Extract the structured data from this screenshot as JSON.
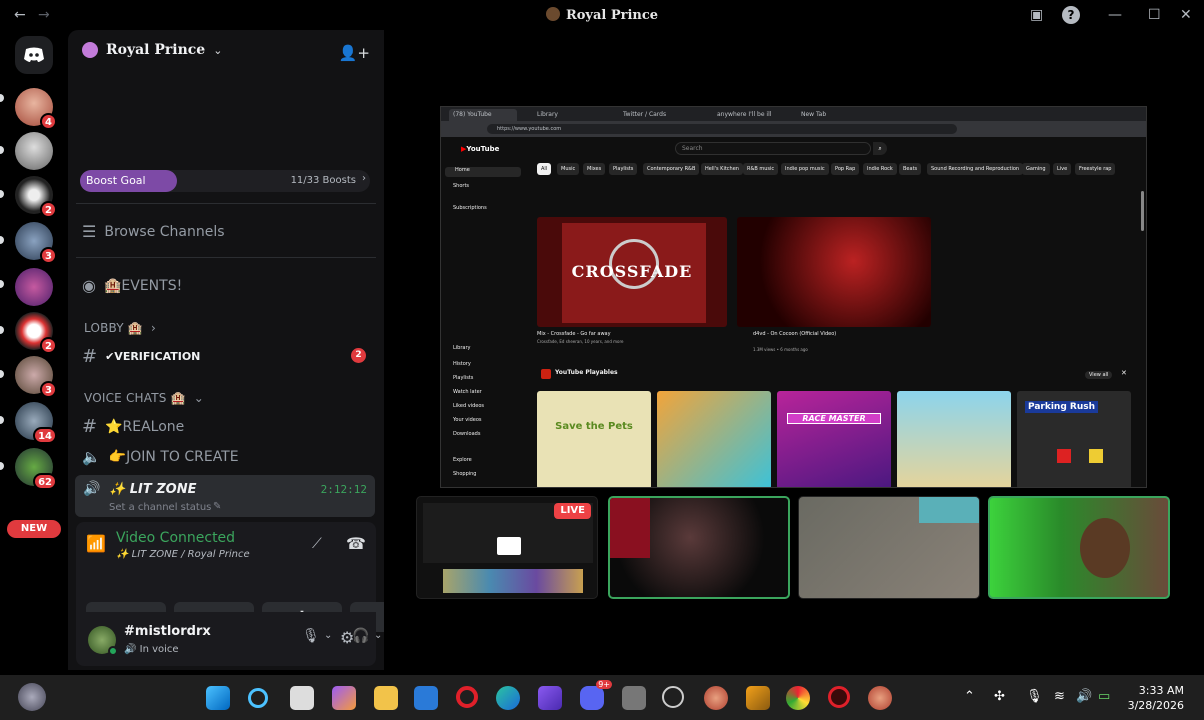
{
  "window": {
    "title": "Royal Prince",
    "back_icon": "back-arrow-icon",
    "forward_icon": "forward-arrow-icon",
    "controls": [
      "inbox-icon",
      "help-icon",
      "minimize-icon",
      "maximize-icon",
      "close-icon"
    ]
  },
  "servers": {
    "badges": [
      "4",
      "2",
      "3",
      "2",
      "3",
      "14",
      "62"
    ],
    "new_label": "NEW"
  },
  "guild": {
    "name": "Royal Prince",
    "boost_label": "Boost Goal",
    "boost_count": "11/33 Boosts",
    "boost_progress": 0.3333
  },
  "channels": {
    "browse": "Browse Channels",
    "events": "🏨EVENTS!",
    "lobby_category": "LOBBY 🏨",
    "verification": "✔VERIFICATION",
    "verification_badge": "2",
    "voice_category": "VOICE CHATS 🏨",
    "realone": "⭐REALone",
    "join_to_create": "👉JOIN TO CREATE",
    "lit_zone": "✨ LIT ZONE",
    "lit_zone_timer": "2:12:12",
    "lit_zone_status": "Set a channel status"
  },
  "voice": {
    "status": "Video Connected",
    "location": "✨ LIT ZONE / Royal Prince"
  },
  "user": {
    "name": "#mistlordrx",
    "status": "In voice"
  },
  "stream": {
    "browser_tabs": [
      "(78) YouTube",
      "Library",
      "Twitter / Cards",
      "anywhere I'll be ill",
      "New Tab"
    ],
    "url": "https://www.youtube.com",
    "yt_logo": "YouTube",
    "search_placeholder": "Search",
    "chips": [
      "All",
      "Music",
      "Mixes",
      "Playlists",
      "Contemporary R&B",
      "Hell's Kitchen",
      "R&B music",
      "Indie pop music",
      "Pop Rap",
      "Indie Rock",
      "Beats",
      "Sound Recording and Reproduction",
      "Gaming",
      "Live",
      "Freestyle rap"
    ],
    "sidebar": [
      "Home",
      "Shorts",
      "Subscriptions",
      "Library",
      "History",
      "Playlists",
      "Watch later",
      "Liked videos",
      "Your videos",
      "Downloads",
      "Explore",
      "Shopping"
    ],
    "videos": [
      {
        "title": "Mix - Crossfade - Go far away",
        "meta": "Crossfade, Ed sheeran, 10 years, and more",
        "thumb_text": "CROSSFADE"
      },
      {
        "title": "d4vd - On Cocoon (Official Video)",
        "meta": "1.3M views • 6 months ago",
        "thumb_text": ""
      }
    ],
    "playables_title": "YouTube Playables",
    "playables": [
      "Save the Pets",
      "",
      "RACE MASTER",
      "",
      "Parking Rush"
    ],
    "view_all": "View all",
    "live_label": "LIVE"
  },
  "taskbar": {
    "time": "3:33 AM",
    "date": "3/28/2026",
    "discord_badge": "9+"
  }
}
